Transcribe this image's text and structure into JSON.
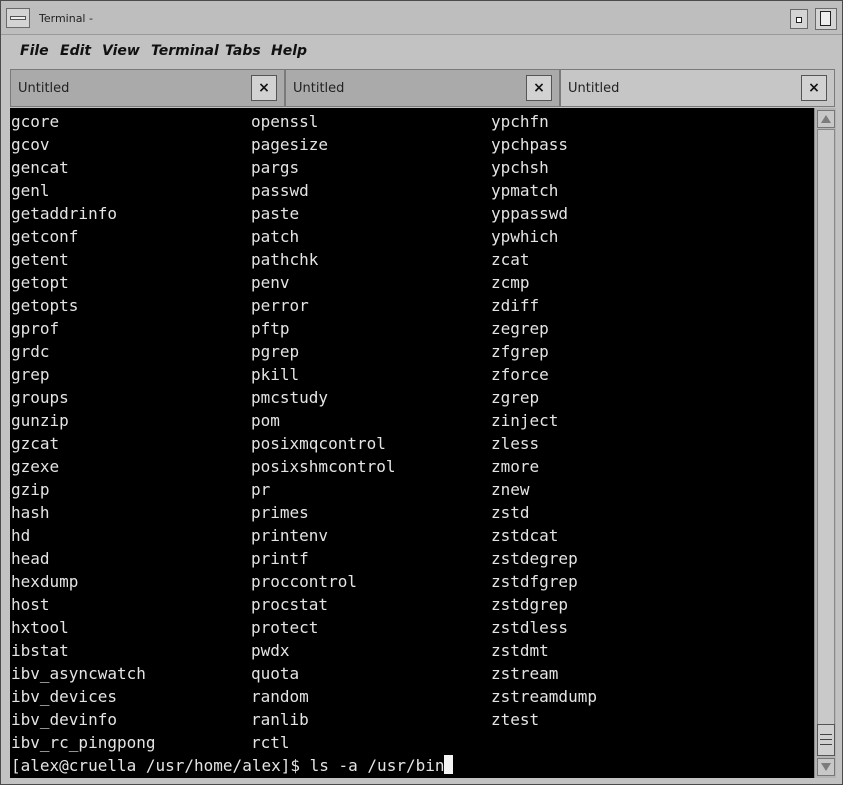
{
  "window": {
    "title": "Terminal -"
  },
  "menu": [
    "File",
    "Edit",
    "View",
    "Terminal",
    "Tabs",
    "Help"
  ],
  "tabs": [
    {
      "label": "Untitled",
      "close": "×",
      "active": false
    },
    {
      "label": "Untitled",
      "close": "×",
      "active": false
    },
    {
      "label": "Untitled",
      "close": "×",
      "active": true
    }
  ],
  "terminal": {
    "rows": [
      [
        "gcore",
        "openssl",
        "ypchfn"
      ],
      [
        "gcov",
        "pagesize",
        "ypchpass"
      ],
      [
        "gencat",
        "pargs",
        "ypchsh"
      ],
      [
        "genl",
        "passwd",
        "ypmatch"
      ],
      [
        "getaddrinfo",
        "paste",
        "yppasswd"
      ],
      [
        "getconf",
        "patch",
        "ypwhich"
      ],
      [
        "getent",
        "pathchk",
        "zcat"
      ],
      [
        "getopt",
        "penv",
        "zcmp"
      ],
      [
        "getopts",
        "perror",
        "zdiff"
      ],
      [
        "gprof",
        "pftp",
        "zegrep"
      ],
      [
        "grdc",
        "pgrep",
        "zfgrep"
      ],
      [
        "grep",
        "pkill",
        "zforce"
      ],
      [
        "groups",
        "pmcstudy",
        "zgrep"
      ],
      [
        "gunzip",
        "pom",
        "zinject"
      ],
      [
        "gzcat",
        "posixmqcontrol",
        "zless"
      ],
      [
        "gzexe",
        "posixshmcontrol",
        "zmore"
      ],
      [
        "gzip",
        "pr",
        "znew"
      ],
      [
        "hash",
        "primes",
        "zstd"
      ],
      [
        "hd",
        "printenv",
        "zstdcat"
      ],
      [
        "head",
        "printf",
        "zstdegrep"
      ],
      [
        "hexdump",
        "proccontrol",
        "zstdfgrep"
      ],
      [
        "host",
        "procstat",
        "zstdgrep"
      ],
      [
        "hxtool",
        "protect",
        "zstdless"
      ],
      [
        "ibstat",
        "pwdx",
        "zstdmt"
      ],
      [
        "ibv_asyncwatch",
        "quota",
        "zstream"
      ],
      [
        "ibv_devices",
        "random",
        "zstreamdump"
      ],
      [
        "ibv_devinfo",
        "ranlib",
        "ztest"
      ],
      [
        "ibv_rc_pingpong",
        "rctl",
        ""
      ]
    ],
    "prompt": "[alex@cruella /usr/home/alex]$ ",
    "command": "ls -a /usr/bin"
  },
  "colors": {
    "terminal_bg": "#000000",
    "terminal_fg": "#e4e4e4",
    "chrome": "#c2c2c2"
  },
  "icons": [
    "window-menu-icon",
    "iconify-icon",
    "maximize-icon",
    "close-icon",
    "scroll-up-icon",
    "scroll-down-icon"
  ]
}
